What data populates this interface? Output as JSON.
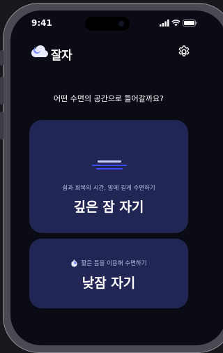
{
  "status_bar": {
    "time": "9:41"
  },
  "header": {
    "app_name": "잘자",
    "logo_icon": "cloud-moon-icon",
    "settings_icon": "gear-icon"
  },
  "question": "어떤 수면의 공간으로 들어갈까요?",
  "cards": {
    "deep_sleep": {
      "subtitle": "쉼과 회복의 시간, 밤에 길게 수면하기",
      "title": "깊은 잠 자기",
      "icon": "moon-icon"
    },
    "nap": {
      "subtitle": "짧은 틈을 이용해 수면하기",
      "title": "낮잠 자기",
      "icon": "timer-icon"
    }
  },
  "colors": {
    "background": "#0a0b14",
    "card": "#212654",
    "accent": "#c9cdff"
  }
}
